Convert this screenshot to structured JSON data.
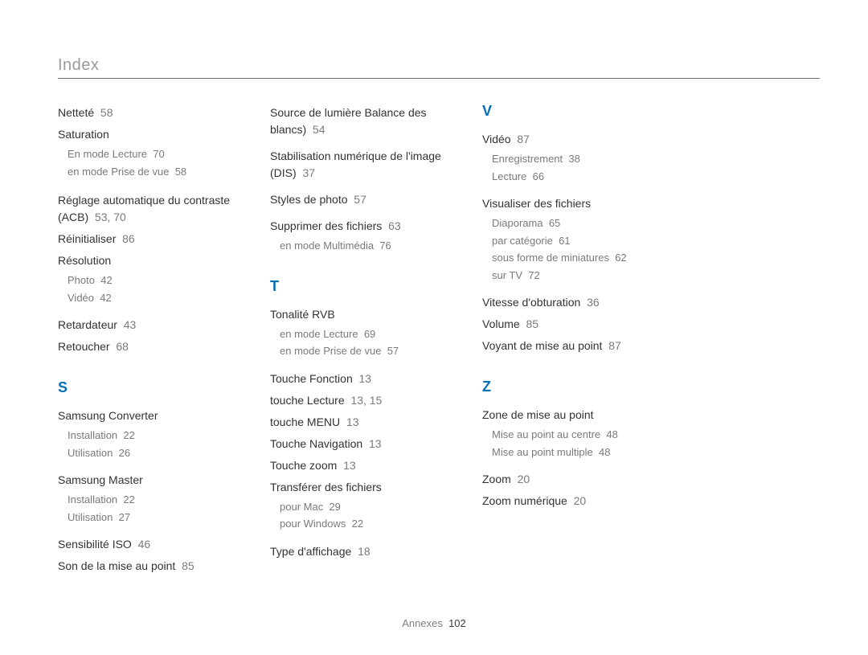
{
  "page_title": "Index",
  "footer": {
    "label": "Annexes",
    "page": "102"
  },
  "col1": {
    "nettete": {
      "term": "Netteté",
      "pg": "58"
    },
    "saturation": {
      "term": "Saturation",
      "subs": [
        {
          "text": "En mode Lecture",
          "pg": "70"
        },
        {
          "text": "en mode Prise de vue",
          "pg": "58"
        }
      ]
    },
    "acb": {
      "term": "Réglage automatique du contraste (ACB)",
      "pg": "53, 70"
    },
    "reinit": {
      "term": "Réinitialiser",
      "pg": "86"
    },
    "reso": {
      "term": "Résolution",
      "subs": [
        {
          "text": "Photo",
          "pg": "42"
        },
        {
          "text": "Vidéo",
          "pg": "42"
        }
      ]
    },
    "retard": {
      "term": "Retardateur",
      "pg": "43"
    },
    "retouch": {
      "term": "Retoucher",
      "pg": "68"
    },
    "alpha_s": "S",
    "sconv": {
      "term": "Samsung Converter",
      "subs": [
        {
          "text": "Installation",
          "pg": "22"
        },
        {
          "text": "Utilisation",
          "pg": "26"
        }
      ]
    },
    "smaster": {
      "term": "Samsung Master",
      "subs": [
        {
          "text": "Installation",
          "pg": "22"
        },
        {
          "text": "Utilisation",
          "pg": "27"
        }
      ]
    },
    "iso": {
      "term": "Sensibilité ISO",
      "pg": "46"
    },
    "son": {
      "term": "Son de la mise au point",
      "pg": "85"
    }
  },
  "col2": {
    "source": {
      "term": "Source de lumière Balance des blancs)",
      "pg": "54"
    },
    "stab": {
      "term": "Stabilisation numérique de l'image (DIS)",
      "pg": "37"
    },
    "styles": {
      "term": "Styles de photo",
      "pg": "57"
    },
    "supp": {
      "term": "Supprimer des fichiers",
      "pg": "63",
      "subs": [
        {
          "text": "en mode Multimédia",
          "pg": "76"
        }
      ]
    },
    "alpha_t": "T",
    "tonal": {
      "term": "Tonalité RVB",
      "subs": [
        {
          "text": "en mode Lecture",
          "pg": "69"
        },
        {
          "text": "en mode Prise de vue",
          "pg": "57"
        }
      ]
    },
    "tfonc": {
      "term": "Touche Fonction",
      "pg": "13"
    },
    "tlect": {
      "term": "touche Lecture",
      "pg": "13, 15"
    },
    "tmenu": {
      "term": "touche MENU",
      "pg": "13"
    },
    "tnav": {
      "term": "Touche Navigation",
      "pg": "13"
    },
    "tzoom": {
      "term": "Touche zoom",
      "pg": "13"
    },
    "transf": {
      "term": "Transférer des fichiers",
      "subs": [
        {
          "text": "pour Mac",
          "pg": "29"
        },
        {
          "text": "pour Windows",
          "pg": "22"
        }
      ]
    },
    "taff": {
      "term": "Type d'affichage",
      "pg": "18"
    }
  },
  "col3": {
    "alpha_v": "V",
    "video": {
      "term": "Vidéo",
      "pg": "87",
      "subs": [
        {
          "text": "Enregistrement",
          "pg": "38"
        },
        {
          "text": "Lecture",
          "pg": "66"
        }
      ]
    },
    "visu": {
      "term": "Visualiser des fichiers",
      "subs": [
        {
          "text": "Diaporama",
          "pg": "65"
        },
        {
          "text": "par catégorie",
          "pg": "61"
        },
        {
          "text": "sous forme de miniatures",
          "pg": "62"
        },
        {
          "text": "sur TV",
          "pg": "72"
        }
      ]
    },
    "vitobt": {
      "term": "Vitesse d'obturation",
      "pg": "36"
    },
    "volume": {
      "term": "Volume",
      "pg": "85"
    },
    "voyant": {
      "term": "Voyant de mise au point",
      "pg": "87"
    },
    "alpha_z": "Z",
    "zone": {
      "term": "Zone de mise au point",
      "subs": [
        {
          "text": "Mise au point au centre",
          "pg": "48"
        },
        {
          "text": "Mise au point multiple",
          "pg": "48"
        }
      ]
    },
    "zoom": {
      "term": "Zoom",
      "pg": "20"
    },
    "zoomn": {
      "term": "Zoom numérique",
      "pg": "20"
    }
  }
}
